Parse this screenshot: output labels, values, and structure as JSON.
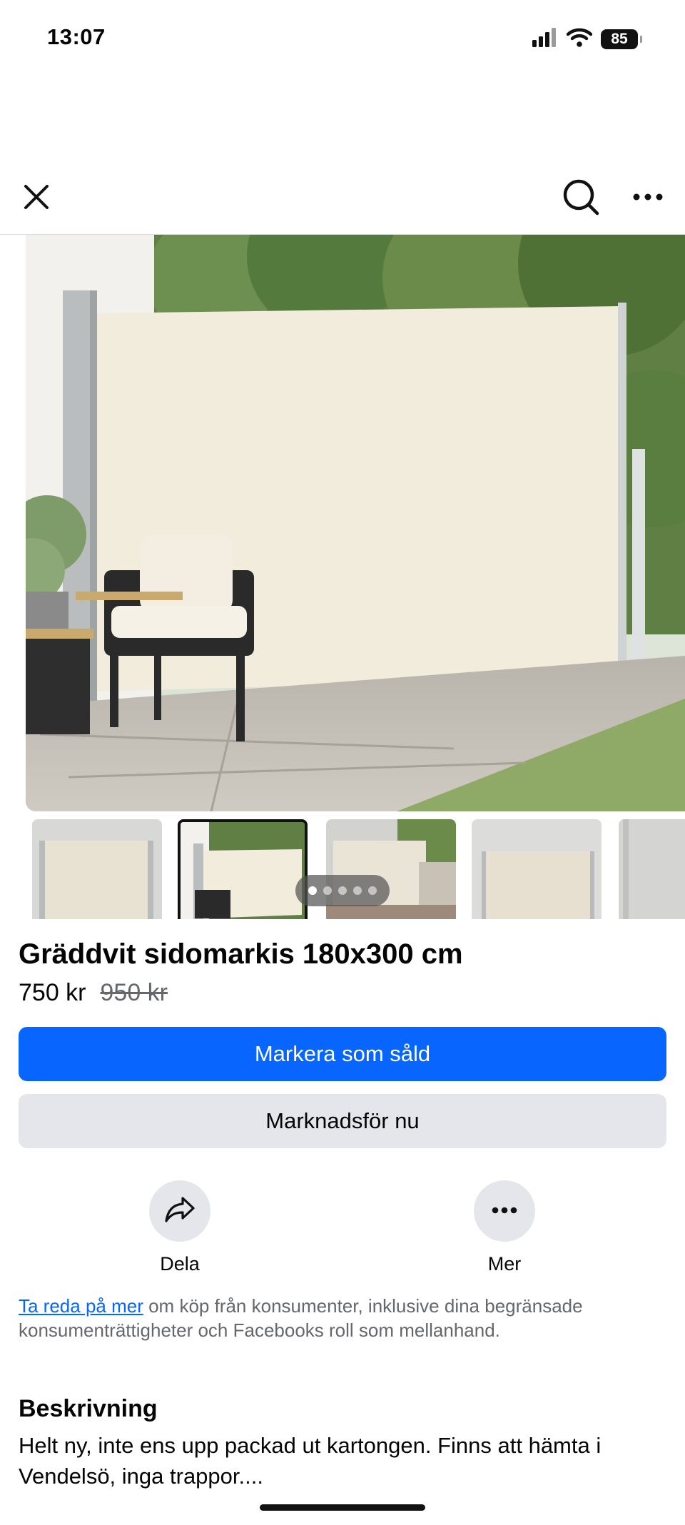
{
  "status_bar": {
    "time": "13:07",
    "battery": "85",
    "icons": [
      "signal-icon",
      "wifi-icon",
      "battery-icon"
    ]
  },
  "nav": {
    "icons": [
      "close-icon",
      "search-icon",
      "more-icon"
    ]
  },
  "gallery": {
    "thumbnail_count": 5,
    "selected_index": 1,
    "page_dots": 5,
    "active_dot": 0
  },
  "listing": {
    "title": "Gräddvit sidomarkis 180x300 cm",
    "price": "750 kr",
    "old_price": "950 kr"
  },
  "buttons": {
    "mark_sold": "Markera som såld",
    "promote": "Marknadsför nu"
  },
  "actions": {
    "share": "Dela",
    "more": "Mer"
  },
  "notice": {
    "link_text": "Ta reda på mer",
    "text": " om köp från konsumenter, inklusive dina begränsade konsumenträttigheter och Facebooks roll som mellanhand."
  },
  "description": {
    "heading": "Beskrivning",
    "text": "Helt ny, inte ens upp packad ut kartongen. Finns att hämta i Vendelsö, inga trappor...."
  },
  "colors": {
    "primary": "#0866ff",
    "secondary_bg": "#e4e6eb",
    "muted_text": "#65676b",
    "text": "#050505"
  }
}
